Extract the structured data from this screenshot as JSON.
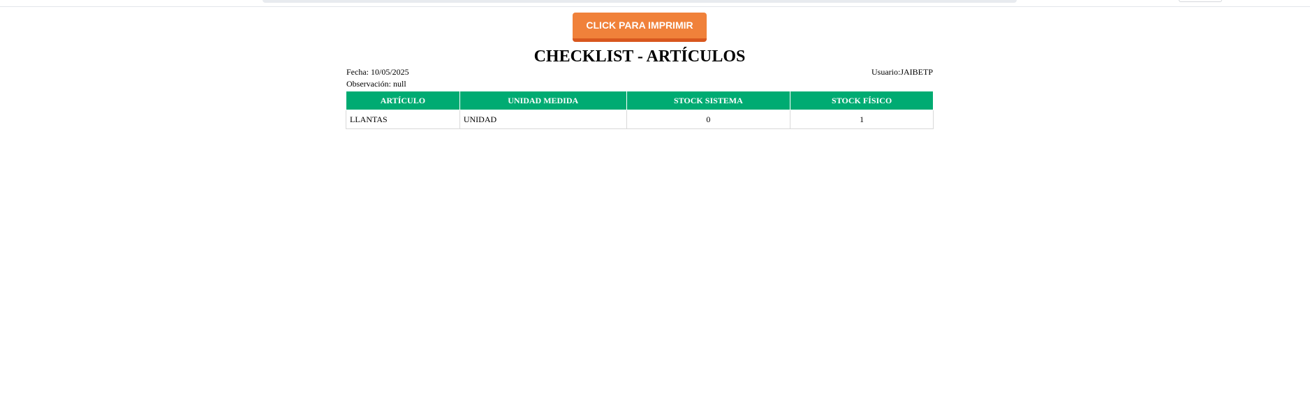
{
  "print_button": {
    "label": "CLICK PARA IMPRIMIR"
  },
  "report": {
    "title": "CHECKLIST - ARTÍCULOS",
    "fecha": "Fecha: 10/05/2025",
    "usuario": "Usuario:JAIBETP",
    "observacion": "Observación: null"
  },
  "table": {
    "headers": [
      "ARTÍCULO",
      "UNIDAD MEDIDA",
      "STOCK SISTEMA",
      "STOCK FÍSICO"
    ],
    "rows": [
      [
        "LLANTAS",
        "UNIDAD",
        "0",
        "1"
      ]
    ]
  },
  "colors": {
    "button": "#f0813a",
    "button_shadow": "#d8571e",
    "table_header": "#00ab72"
  }
}
